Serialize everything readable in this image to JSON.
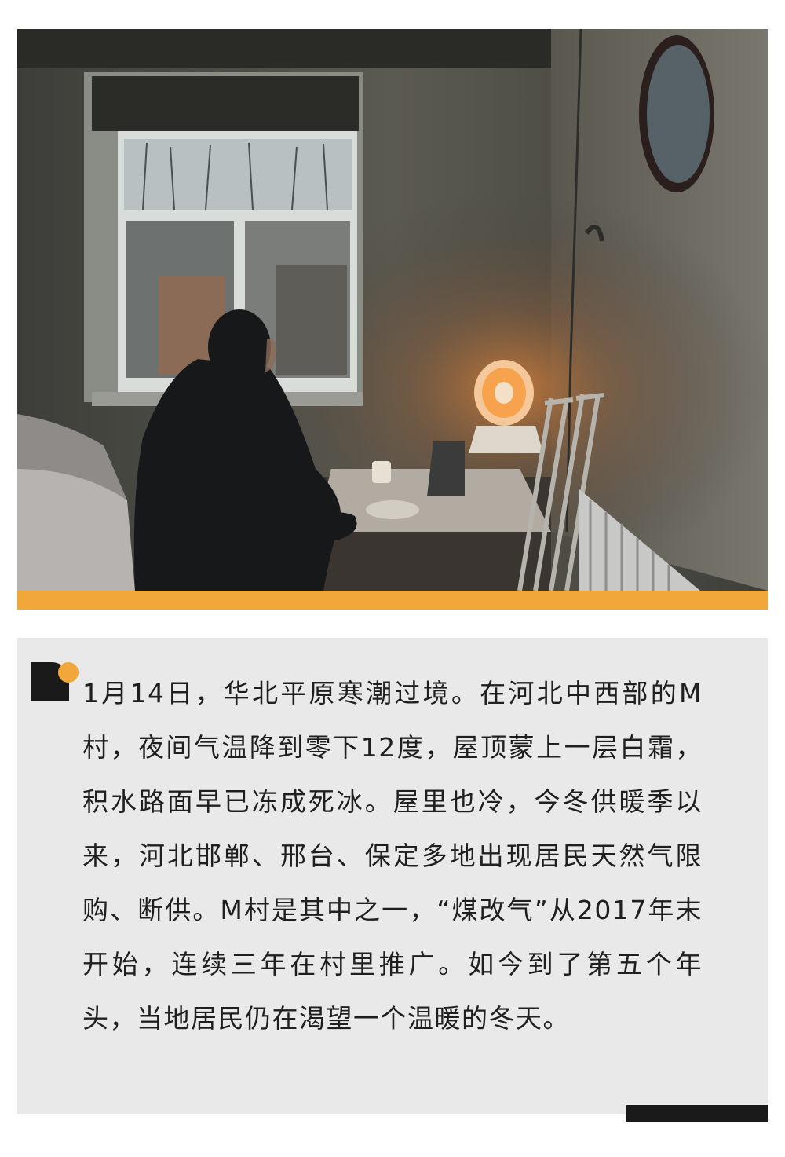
{
  "photo": {
    "subject": "Man sitting by a window in a cold room next to a small electric heater and crutches"
  },
  "colors": {
    "accent": "#f2a73b",
    "dark": "#1a1a1a",
    "caption_bg": "#e9e9e9"
  },
  "caption": {
    "icon": "quote-corner-icon",
    "text": "1月14日，华北平原寒潮过境。在河北中西部的M村，夜间气温降到零下12度，屋顶蒙上一层白霜，积水路面早已冻成死冰。屋里也冷，今冬供暖季以来，河北邯郸、邢台、保定多地出现居民天然气限购、断供。M村是其中之一，“煤改气”从2017年末开始，连续三年在村里推广。如今到了第五个年头，当地居民仍在渴望一个温暖的冬天。"
  }
}
